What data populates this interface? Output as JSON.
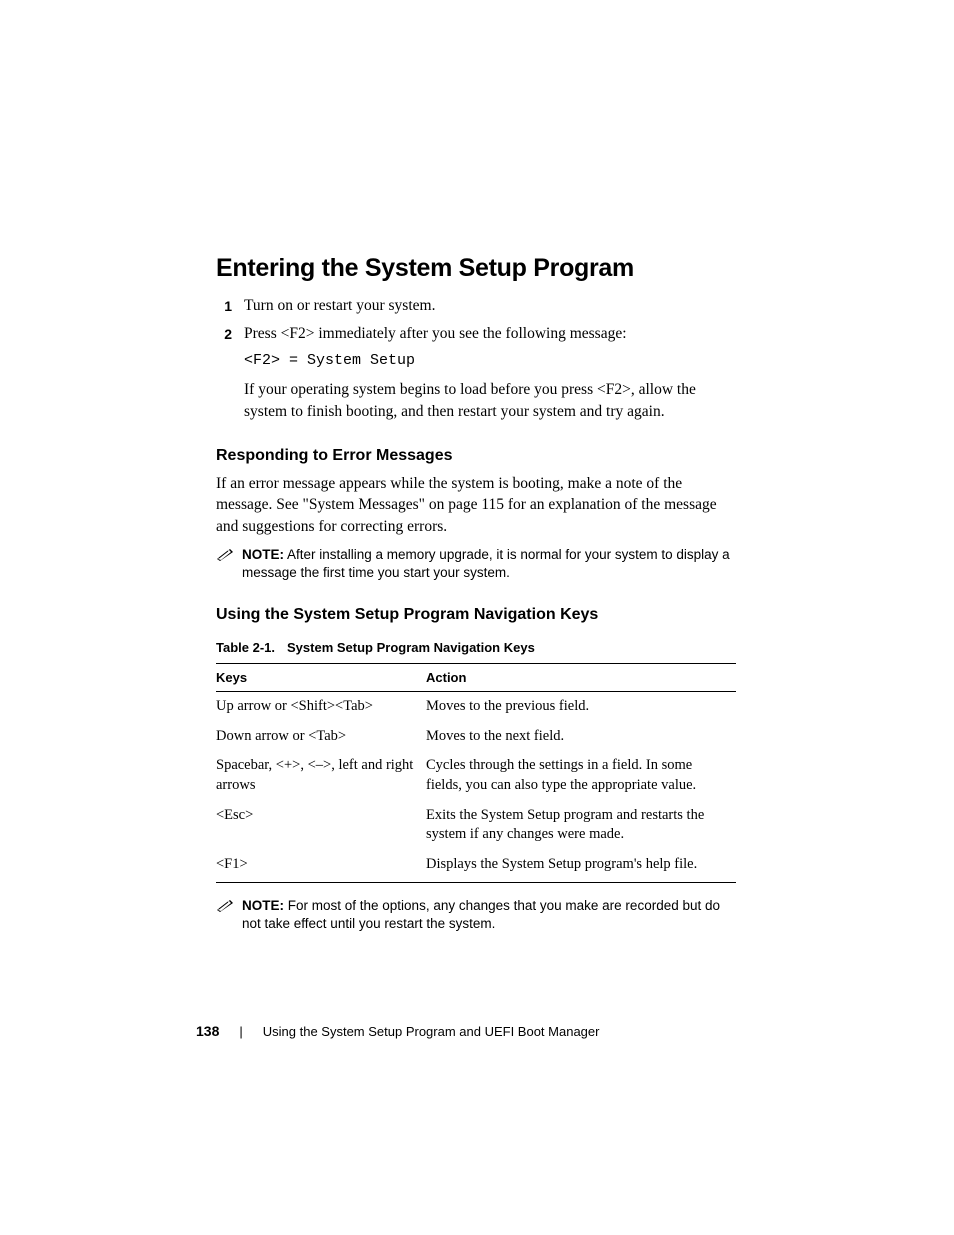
{
  "heading": "Entering the System Setup Program",
  "steps": [
    {
      "num": "1",
      "text": "Turn on or restart your system."
    },
    {
      "num": "2",
      "text": "Press <F2> immediately after you see the following message:",
      "code": "<F2> = System Setup",
      "after": "If your operating system begins to load before you press <F2>, allow the system to finish booting, and then restart your system and try again."
    }
  ],
  "sectionA": {
    "title": "Responding to Error Messages",
    "body": "If an error message appears while the system is booting, make a note of the message. See \"System Messages\" on page 115 for an explanation of the message and suggestions for correcting errors.",
    "note_label": "NOTE:",
    "note_text": " After installing a memory upgrade, it is normal for your system to display a message the first time you start your system."
  },
  "sectionB": {
    "title": "Using the System Setup Program Navigation Keys",
    "table_caption_num": "Table 2-1.",
    "table_caption_title": "System Setup Program Navigation Keys",
    "columns": {
      "keys": "Keys",
      "action": "Action"
    },
    "rows": [
      {
        "keys": "Up arrow or <Shift><Tab>",
        "action": "Moves to the previous field."
      },
      {
        "keys": "Down arrow or <Tab>",
        "action": "Moves to the next field."
      },
      {
        "keys": "Spacebar, <+>, <–>, left and right arrows",
        "action": "Cycles through the settings in a field. In some fields, you can also type the appropriate value."
      },
      {
        "keys": "<Esc>",
        "action": "Exits the System Setup program and restarts the system if any changes were made."
      },
      {
        "keys": "<F1>",
        "action": "Displays the System Setup program's help file."
      }
    ],
    "note_label": "NOTE:",
    "note_text": " For most of the options, any changes that you make are recorded but do not take effect until you restart the system."
  },
  "footer": {
    "page_num": "138",
    "chapter": "Using the System Setup Program and UEFI Boot Manager"
  }
}
